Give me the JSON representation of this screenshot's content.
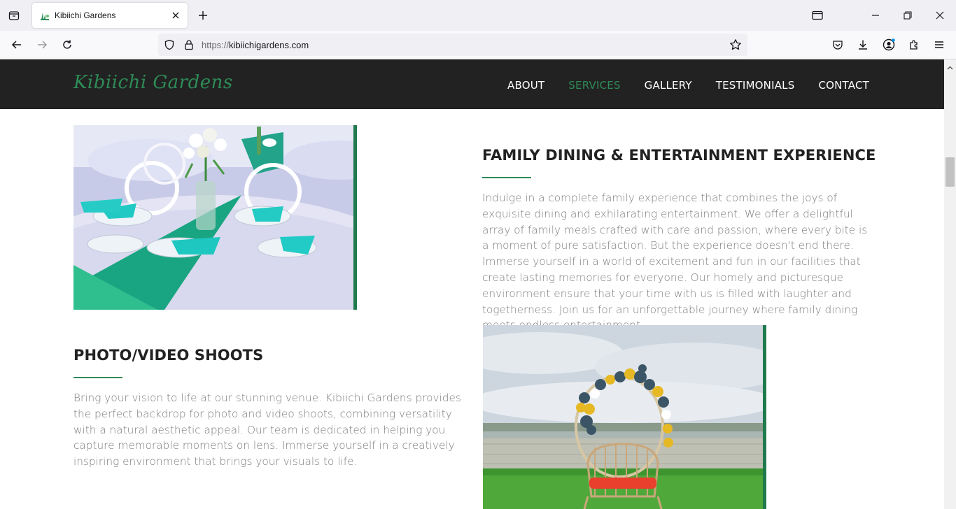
{
  "browser": {
    "tab_title": "Kibiichi Gardens",
    "url_protocol": "https://",
    "url_host": "kibiichigardens.com"
  },
  "site": {
    "logo": "Kibiichi Gardens",
    "nav": [
      {
        "label": "ABOUT",
        "active": false
      },
      {
        "label": "SERVICES",
        "active": true
      },
      {
        "label": "GALLERY",
        "active": false
      },
      {
        "label": "TESTIMONIALS",
        "active": false
      },
      {
        "label": "CONTACT",
        "active": false
      }
    ],
    "accent_color": "#2e8b57",
    "header_bg": "#222222"
  },
  "sections": {
    "family": {
      "title": "FAMILY DINING & ENTERTAINMENT EXPERIENCE",
      "text": "Indulge in a complete family experience that combines the joys of exquisite dining and exhilarating entertainment. We offer a delightful array of family meals crafted with care and passion, where every bite is a moment of pure satisfaction. But the experience doesn't end there. Immerse yourself in a world of excitement and fun in our facilities that create lasting memories for everyone. Our homely and picturesque environment ensure that your time with us is filled with laughter and togetherness. Join us for an unforgettable journey where family dining meets endless entertainment."
    },
    "photo": {
      "title": "PHOTO/VIDEO SHOOTS",
      "text": "Bring your vision to life at our stunning venue. Kibiichi Gardens provides the perfect backdrop for photo and video shoots, combining versatility with a natural aesthetic appeal. Our team is dedicated in helping you capture memorable moments on lens. Immerse yourself in a creatively inspiring environment that brings your visuals to life."
    }
  }
}
